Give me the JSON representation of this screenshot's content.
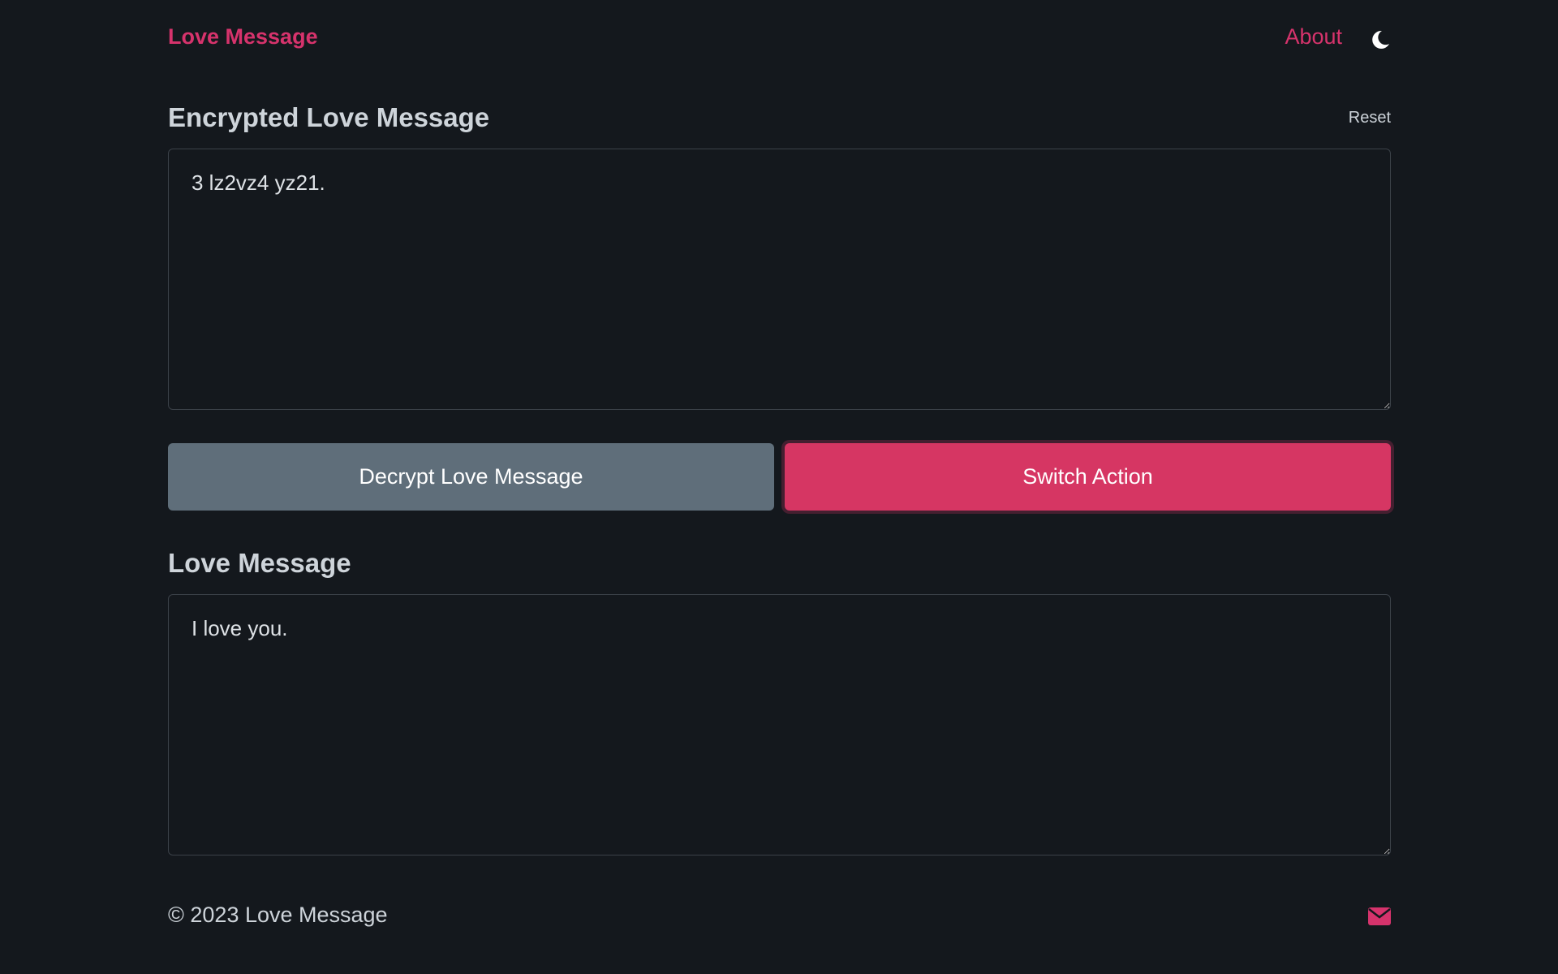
{
  "navbar": {
    "brand": "Love Message",
    "about": "About",
    "theme_icon": "moon-icon"
  },
  "encrypted_section": {
    "title": "Encrypted Love Message",
    "reset_label": "Reset",
    "value": "3 lz2vz4 yz21."
  },
  "actions": {
    "decrypt_label": "Decrypt Love Message",
    "switch_label": "Switch Action"
  },
  "message_section": {
    "title": "Love Message",
    "value": "I love you."
  },
  "footer": {
    "copyright": "© 2023 Love Message",
    "contact_icon": "envelope-icon"
  },
  "colors": {
    "background": "#14181d",
    "accent": "#d6336c",
    "secondary_button": "#5f6e7a",
    "text": "#ced4da"
  }
}
